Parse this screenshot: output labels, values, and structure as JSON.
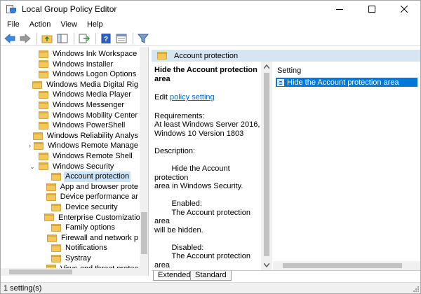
{
  "window": {
    "title": "Local Group Policy Editor",
    "controls": [
      "minimize-icon",
      "maximize-icon",
      "close-icon"
    ]
  },
  "menu": {
    "items": [
      "File",
      "Action",
      "View",
      "Help"
    ]
  },
  "toolbar": {
    "icons": [
      "back-arrow-icon",
      "forward-arrow-icon",
      "folder-up-icon",
      "show-hide-console-tree-icon",
      "export-list-icon",
      "help-icon",
      "properties-icon",
      "filter-icon"
    ]
  },
  "tree": {
    "items": [
      {
        "label": "Windows Ink Workspace",
        "expander": ""
      },
      {
        "label": "Windows Installer",
        "expander": ""
      },
      {
        "label": "Windows Logon Options",
        "expander": ""
      },
      {
        "label": "Windows Media Digital Rig",
        "expander": ""
      },
      {
        "label": "Windows Media Player",
        "expander": ""
      },
      {
        "label": "Windows Messenger",
        "expander": ""
      },
      {
        "label": "Windows Mobility Center",
        "expander": ""
      },
      {
        "label": "Windows PowerShell",
        "expander": ""
      },
      {
        "label": "Windows Reliability Analys",
        "expander": ""
      },
      {
        "label": "Windows Remote Manage",
        "expander": "›"
      },
      {
        "label": "Windows Remote Shell",
        "expander": ""
      },
      {
        "label": "Windows Security",
        "expander": "⌄"
      },
      {
        "label": "Account protection",
        "expander": "",
        "selected": true,
        "child": true
      },
      {
        "label": "App and browser prote",
        "expander": "",
        "child": true
      },
      {
        "label": "Device performance ar",
        "expander": "",
        "child": true
      },
      {
        "label": "Device security",
        "expander": "",
        "child": true
      },
      {
        "label": "Enterprise Customizatio",
        "expander": "",
        "child": true
      },
      {
        "label": "Family options",
        "expander": "",
        "child": true
      },
      {
        "label": "Firewall and network p",
        "expander": "",
        "child": true
      },
      {
        "label": "Notifications",
        "expander": "",
        "child": true
      },
      {
        "label": "Systray",
        "expander": "",
        "child": true
      },
      {
        "label": "Virus and threat protec",
        "expander": "",
        "child": true
      }
    ]
  },
  "header": {
    "title": "Account protection"
  },
  "description": {
    "policy_title": "Hide the Account protection area",
    "edit_prefix": "Edit",
    "edit_link": "policy setting",
    "requirements": "Requirements:\nAt least Windows Server 2016,\nWindows 10 Version 1803",
    "description_text": "Description:\n\n        Hide the Account protection\narea in Windows Security.\n\n        Enabled:\n        The Account protection area\nwill be hidden.\n\n        Disabled:\n        The Account protection area\nwill be shown.\n\n        Not configured:\n        Same as Disabled."
  },
  "list": {
    "column_header": "Setting",
    "rows": [
      "Hide the Account protection area"
    ]
  },
  "tabs": [
    "Extended",
    "Standard"
  ],
  "status": {
    "text": "1 setting(s)"
  },
  "colors": {
    "selection": "#0078d7",
    "header_band": "#d7e4f2",
    "link": "#0066cc"
  }
}
